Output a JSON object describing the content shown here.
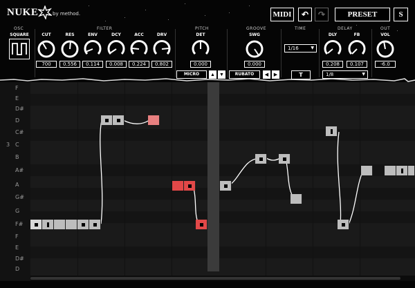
{
  "brand": {
    "name": "NUKE",
    "by": "by",
    "maker": "method."
  },
  "header": {
    "midi": "MIDI",
    "undo": "↶",
    "redo": "↷",
    "preset": "PRESET",
    "s": "S"
  },
  "sections": {
    "osc": "OSC",
    "filter": "FILTER",
    "pitch": "PITCH",
    "groove": "GROOVE",
    "time": "TIME",
    "delay": "DELAY",
    "out": "OUT"
  },
  "osc": {
    "label": "SQUARE"
  },
  "filter": [
    {
      "label": "CUT",
      "value": "700"
    },
    {
      "label": "RES",
      "value": "0.556"
    },
    {
      "label": "ENV",
      "value": "0.114"
    },
    {
      "label": "DCY",
      "value": "0.008"
    },
    {
      "label": "ACC",
      "value": "0.224"
    },
    {
      "label": "DRV",
      "value": "0.802"
    }
  ],
  "pitch": {
    "label": "DET",
    "value": "0.000",
    "micro": "MICRO"
  },
  "groove": {
    "label": "SWG",
    "value": "0.000",
    "rubato": "RUBATO"
  },
  "time": {
    "division": "1/16",
    "tie": "T"
  },
  "delay": [
    {
      "label": "DLY",
      "value": "0.208"
    },
    {
      "label": "FB",
      "value": "0.107"
    }
  ],
  "delay_division": "1/8",
  "out": {
    "label": "VOL",
    "value": "-6.0"
  },
  "roll": {
    "keys": [
      "F",
      "E",
      "D#",
      "D",
      "C#",
      "C",
      "B",
      "A#",
      "A",
      "G#",
      "G",
      "F#",
      "F",
      "E",
      "D#",
      "D"
    ],
    "octave_label": "3"
  },
  "colors": {
    "note": "#bdbdbd",
    "note_active": "#e24848",
    "note_faded": "#e88080",
    "background": "#050505"
  }
}
